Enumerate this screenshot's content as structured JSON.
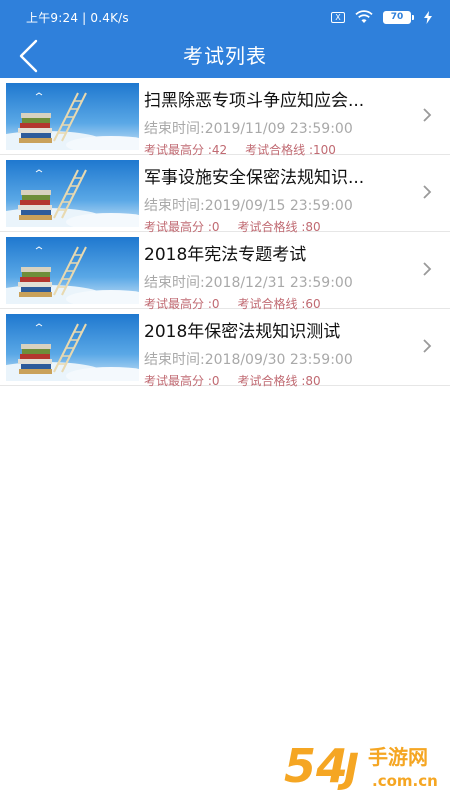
{
  "status_bar": {
    "time_speed": "上午9:24 | 0.4K/s",
    "sim": "X",
    "battery": "70"
  },
  "header": {
    "title": "考试列表"
  },
  "exams": [
    {
      "title": "扫黑除恶专项斗争应知应会...",
      "end_time": "结束时间:2019/11/09 23:59:00",
      "max_score": "考试最高分 :42",
      "pass_line": "考试合格线 :100"
    },
    {
      "title": "军事设施安全保密法规知识...",
      "end_time": "结束时间:2019/09/15 23:59:00",
      "max_score": "考试最高分 :0",
      "pass_line": "考试合格线 :80"
    },
    {
      "title": "2018年宪法专题考试",
      "end_time": "结束时间:2018/12/31 23:59:00",
      "max_score": "考试最高分 :0",
      "pass_line": "考试合格线 :60"
    },
    {
      "title": "2018年保密法规知识测试",
      "end_time": "结束时间:2018/09/30 23:59:00",
      "max_score": "考试最高分 :0",
      "pass_line": "考试合格线 :80"
    }
  ],
  "watermark": {
    "digits": "54",
    "text": "手游网",
    "domain": ".com.cn"
  },
  "colors": {
    "header_blue": "#2F80DB",
    "score_red": "#c06a72",
    "muted_gray": "#a9a9a9",
    "watermark_orange": "#f5a623"
  }
}
